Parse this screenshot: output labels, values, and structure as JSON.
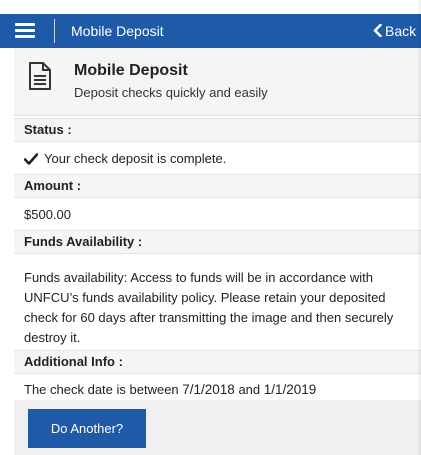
{
  "topbar": {
    "title": "Mobile Deposit",
    "back_label": "Back"
  },
  "header": {
    "title": "Mobile Deposit",
    "subtitle": "Deposit checks quickly and easily"
  },
  "status": {
    "label": "Status :",
    "value": "Your check deposit is complete."
  },
  "amount": {
    "label": "Amount :",
    "value": "$500.00"
  },
  "funds": {
    "label": "Funds Availability :",
    "text": "Funds availability: Access to funds will be in accordance with UNFCU’s funds availability policy. Please retain your deposited check for 60 days after transmitting the image and then securely destroy it."
  },
  "additional": {
    "label": "Additional Info :",
    "prefix": "The check date is between ",
    "start_date": "7/1/2018",
    "middle": " and ",
    "end_date": "1/1/2019"
  },
  "actions": {
    "do_another_label": "Do Another?"
  },
  "colors": {
    "accent": "#1e5aa8",
    "panel": "#f5f5f5"
  }
}
